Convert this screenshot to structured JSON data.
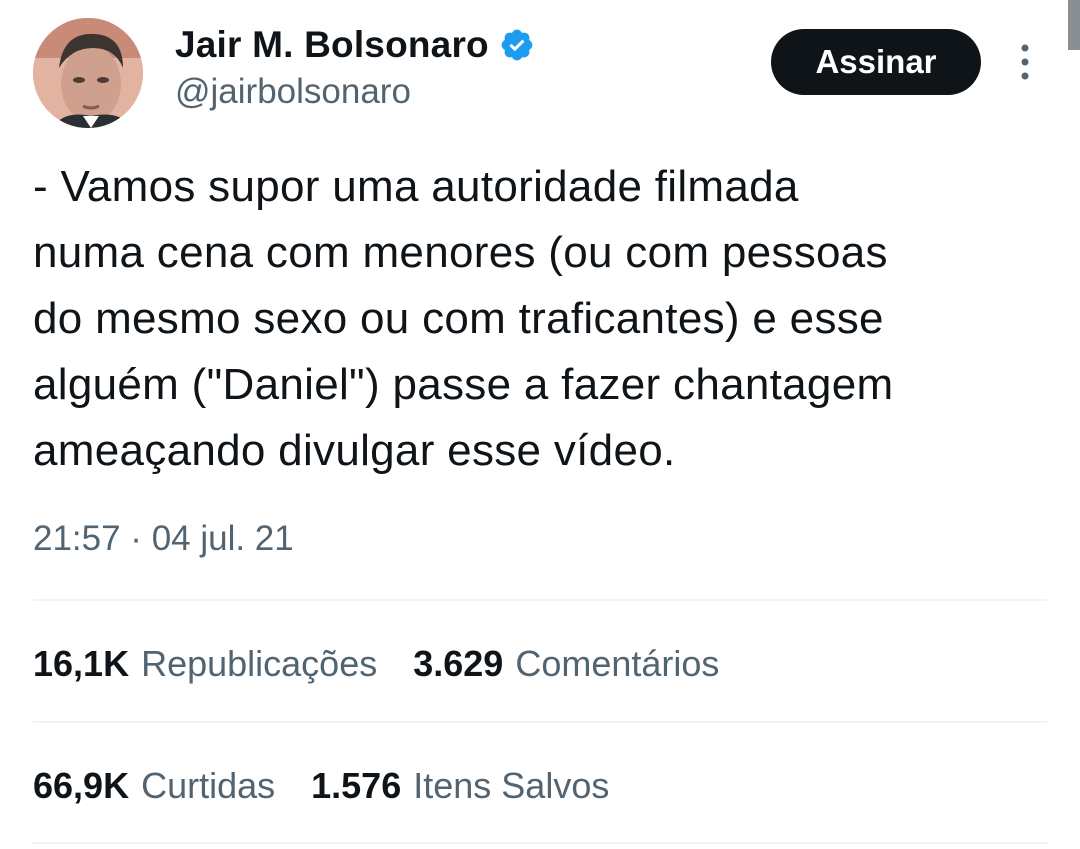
{
  "author": {
    "display_name": "Jair M. Bolsonaro",
    "handle": "@jairbolsonaro",
    "verified": true,
    "verified_color": "#1d9bf0"
  },
  "actions": {
    "subscribe_label": "Assinar",
    "more_icon": "more-vertical-icon"
  },
  "tweet": {
    "text_lines": [
      "- Vamos supor uma autoridade filmada",
      "numa cena com menores (ou com pessoas",
      "do mesmo sexo ou com traficantes) e esse",
      "alguém (\"Daniel\") passe a fazer chantagem",
      "ameaçando divulgar esse vídeo."
    ],
    "timestamp": "21:57 · 04 jul. 21"
  },
  "stats": {
    "retweets": {
      "count": "16,1K",
      "label": "Republicações"
    },
    "comments": {
      "count": "3.629",
      "label": "Comentários"
    },
    "likes": {
      "count": "66,9K",
      "label": "Curtidas"
    },
    "bookmarks": {
      "count": "1.576",
      "label": "Itens Salvos"
    }
  },
  "colors": {
    "text_primary": "#0f1419",
    "text_secondary": "#536471",
    "button_bg": "#0f1419",
    "divider": "#eff3f4"
  }
}
